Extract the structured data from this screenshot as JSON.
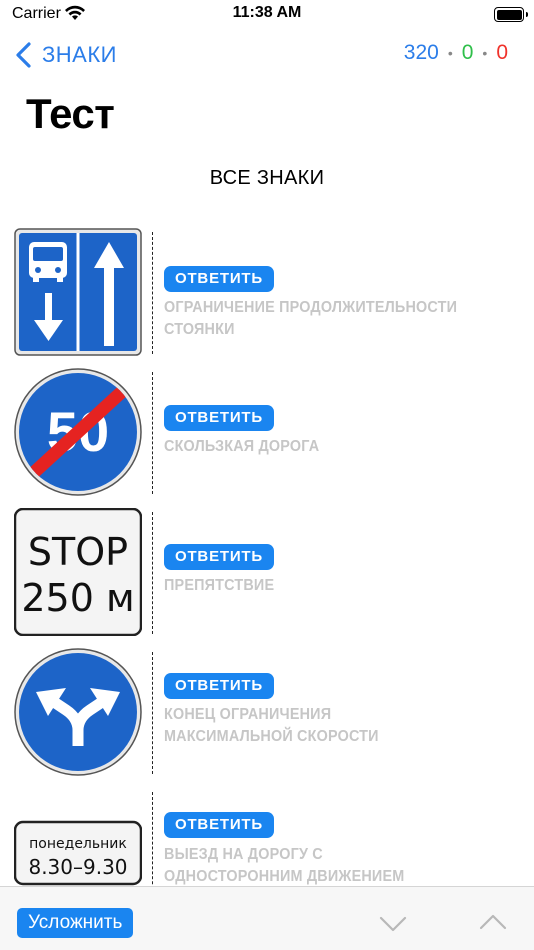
{
  "status": {
    "carrier": "Carrier",
    "time": "11:38 AM"
  },
  "nav": {
    "back_label": "ЗНАКИ",
    "counts": {
      "total": "320",
      "correct": "0",
      "wrong": "0"
    }
  },
  "page": {
    "title": "Тест",
    "section": "ВСЕ ЗНАКИ"
  },
  "answer_label": "ОТВЕТИТЬ",
  "signs": [
    {
      "icon": "bus-lane-sign-icon",
      "option_line1": "ОГРАНИЧЕНИЕ ПРОДОЛЖИТЕЛЬНОСТИ СТОЯНКИ",
      "option_line2": ""
    },
    {
      "icon": "end-speed-limit-50-sign-icon",
      "number": "50",
      "option_line1": "СКОЛЬЗКАЯ ДОРОГА",
      "option_line2": ""
    },
    {
      "icon": "stop-250m-sign-icon",
      "line1": "STOP",
      "line2": "250 м",
      "option_line1": "ПРЕПЯТСТВИЕ",
      "option_line2": ""
    },
    {
      "icon": "left-or-right-detour-sign-icon",
      "option_line1": "КОНЕЦ ОГРАНИЧЕНИЯ",
      "option_line2": "МАКСИМАЛЬНОЙ СКОРОСТИ"
    },
    {
      "icon": "monday-time-plate-sign-icon",
      "line1": "понедельник",
      "line2": "8.30–9.30",
      "option_line1": "ВЫЕЗД НА ДОРОГУ С",
      "option_line2": "ОДНОСТОРОННИМ ДВИЖЕНИЕМ"
    }
  ],
  "toolbar": {
    "complicate_label": "Усложнить"
  },
  "colors": {
    "accent": "#1a85f0",
    "correct": "#2fbf4a",
    "wrong": "#f0322b",
    "sign_blue": "#1d64c8"
  }
}
